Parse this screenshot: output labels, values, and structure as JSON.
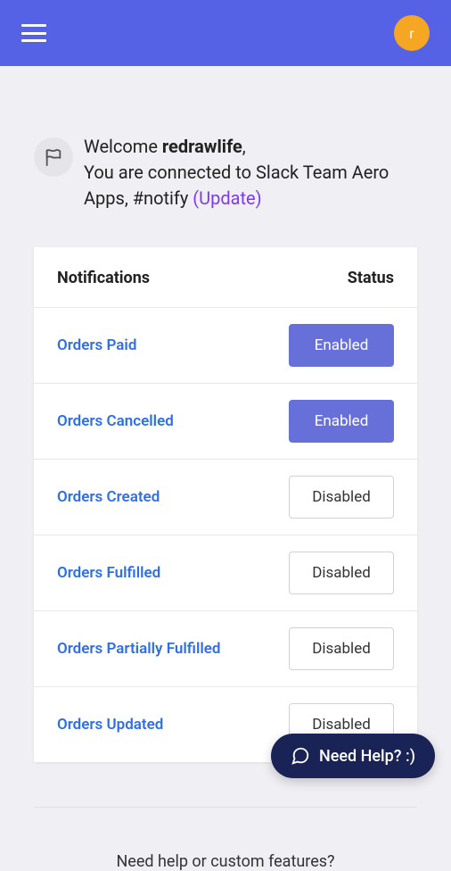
{
  "header": {
    "avatar_initial": "r"
  },
  "welcome": {
    "greeting_prefix": "Welcome ",
    "username": "redrawlife",
    "greeting_suffix": ",",
    "connection_text_1": "You are connected to Slack Team Aero Apps, ",
    "channel": "#notify",
    "update_label": "(Update)"
  },
  "table": {
    "header_notifications": "Notifications",
    "header_status": "Status",
    "status_enabled_label": "Enabled",
    "status_disabled_label": "Disabled",
    "rows": [
      {
        "label": "Orders Paid",
        "enabled": true
      },
      {
        "label": "Orders Cancelled",
        "enabled": true
      },
      {
        "label": "Orders Created",
        "enabled": false
      },
      {
        "label": "Orders Fulfilled",
        "enabled": false
      },
      {
        "label": "Orders Partially Fulfilled",
        "enabled": false
      },
      {
        "label": "Orders Updated",
        "enabled": false
      }
    ]
  },
  "footer": {
    "help_text": "Need help or custom features?"
  },
  "help_widget": {
    "label": "Need Help? :)"
  }
}
